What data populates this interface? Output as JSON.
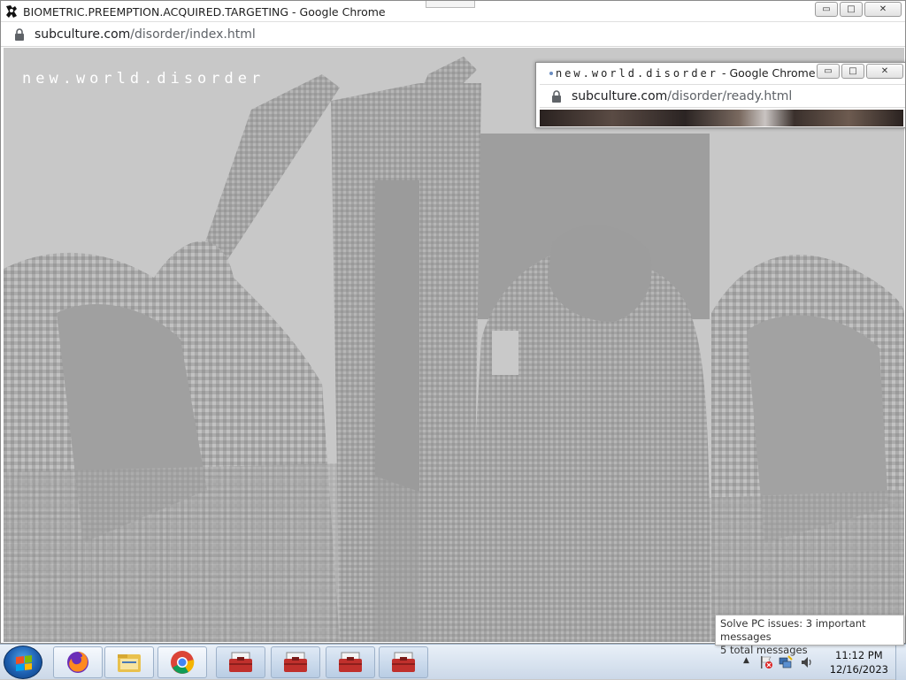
{
  "main_window": {
    "title": "BIOMETRIC.PREEMPTION.ACQUIRED.TARGETING - Google Chrome",
    "url_host": "subculture.com",
    "url_path": "/disorder/index.html",
    "site_title": "new.world.disorder",
    "controls": {
      "minimize": "▭",
      "maximize": "□",
      "close": "✕"
    }
  },
  "popup_window": {
    "title_spaced": "new.world.disorder",
    "title_suffix": " - Google Chrome",
    "url_host": "subculture.com",
    "url_path": "/disorder/ready.html",
    "controls": {
      "minimize": "▭",
      "maximize": "□",
      "close": "✕"
    }
  },
  "taskbar": {
    "items": [
      {
        "name": "firefox",
        "icon": "firefox-icon"
      },
      {
        "name": "file-explorer",
        "icon": "folder-icon"
      },
      {
        "name": "chrome",
        "icon": "chrome-icon"
      },
      {
        "name": "app-1",
        "icon": "toolbox-icon"
      },
      {
        "name": "app-2",
        "icon": "toolbox-icon"
      },
      {
        "name": "app-3",
        "icon": "toolbox-icon"
      },
      {
        "name": "app-4",
        "icon": "toolbox-icon"
      }
    ],
    "tray_arrow": "▲",
    "time": "11:12 PM",
    "date": "12/16/2023"
  },
  "notification": {
    "line1": "Solve PC issues: 3 important messages",
    "line2": "5 total messages"
  },
  "colors": {
    "page_bg": "#c8c8c8",
    "image_dark": "#9c9c9c",
    "image_mid": "#a9a9a9",
    "taskbar": "#d6e1ef"
  }
}
